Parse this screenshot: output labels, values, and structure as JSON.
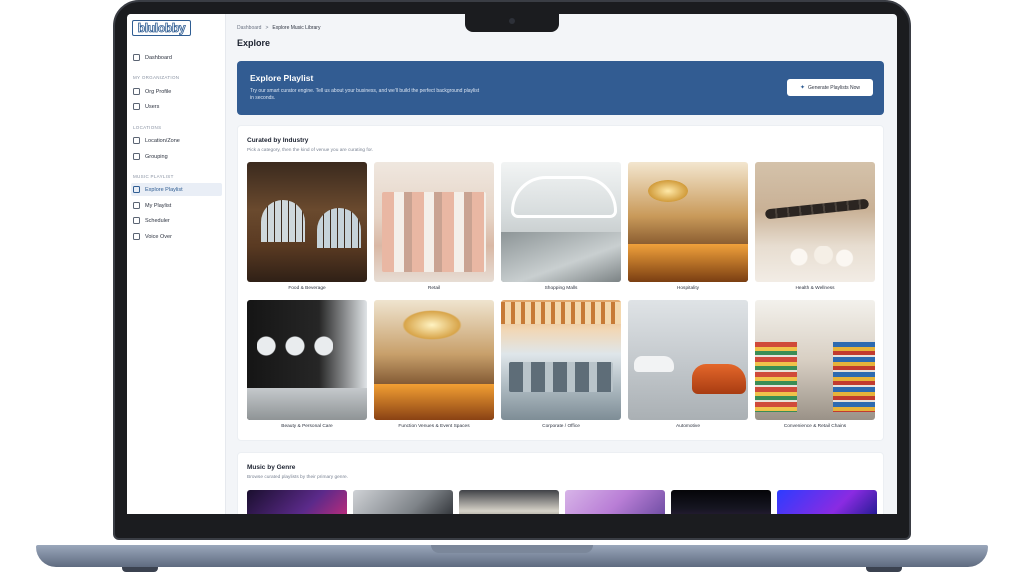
{
  "sidebar": {
    "logo": "blulobby",
    "items": {
      "dashboard": "Dashboard",
      "org_profile": "Org Profile",
      "users": "Users",
      "location_zone": "Location/Zone",
      "grouping": "Grouping",
      "explore_playlist": "Explore Playlist",
      "my_playlist": "My Playlist",
      "scheduler": "Scheduler",
      "voice_over": "Voice Over"
    },
    "sections": {
      "org": "MY ORGANIZATION",
      "locations": "LOCATIONS",
      "music": "MUSIC PLAYLIST"
    },
    "active": "Explore Playlist"
  },
  "header": {
    "breadcrumb": [
      "Dashboard",
      ">",
      "Explore Music Library"
    ],
    "title": "Explore"
  },
  "banner": {
    "title": "Explore Playlist",
    "text": "Try our smart curator engine. Tell us about your business, and we'll build the perfect background playlist in seconds.",
    "button": "Generate Playlists Now",
    "color": "#325c92"
  },
  "industry": {
    "title": "Curated by Industry",
    "subtitle": "Pick a category, then the kind of venue you are curating for.",
    "tiles": [
      "Food & Beverage",
      "Retail",
      "Shopping Malls",
      "Hospitality",
      "Health & Wellness",
      "Beauty & Personal Care",
      "Function Venues & Event Spaces",
      "Corporate / Office",
      "Automotive",
      "Convenience & Retail Chains"
    ]
  },
  "genre": {
    "title": "Music by Genre",
    "subtitle": "Browse curated playlists by their primary genre."
  }
}
